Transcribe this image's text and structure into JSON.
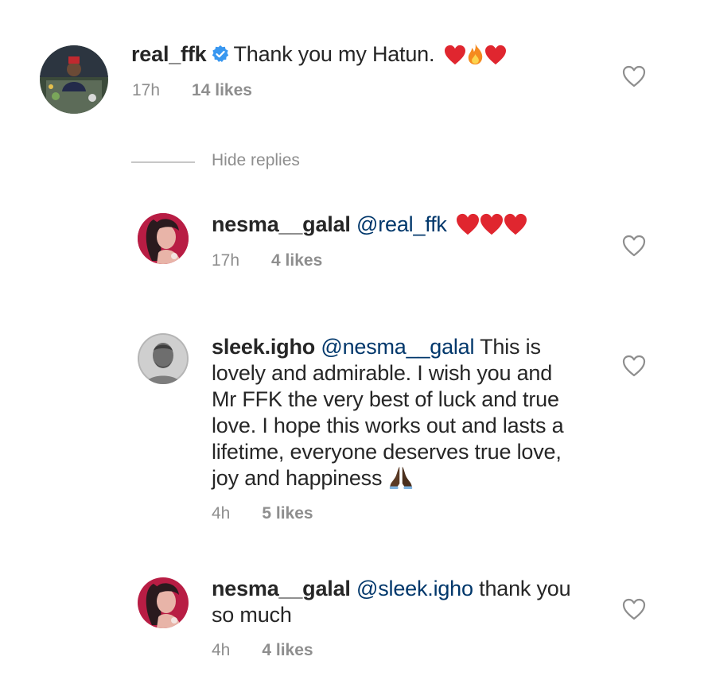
{
  "comments": [
    {
      "username": "real_ffk",
      "verified": true,
      "mention": "",
      "text": "Thank you my Hatun.",
      "emojis": [
        "red-heart",
        "fire",
        "red-heart"
      ],
      "time": "17h",
      "likes": "14 likes"
    }
  ],
  "hide_replies_label": "Hide replies",
  "replies": [
    {
      "username": "nesma__galal",
      "mention": "@real_ffk",
      "text": "",
      "emojis": [
        "red-heart",
        "red-heart",
        "red-heart"
      ],
      "time": "17h",
      "likes": "4 likes"
    },
    {
      "username": "sleek.igho",
      "mention": "@nesma__galal",
      "text_lines": [
        "This is",
        "lovely and admirable. I wish you and",
        "Mr FFK the very best of luck and true",
        "love. I hope this works out and lasts a",
        "lifetime, everyone deserves true love,",
        "joy and happiness"
      ],
      "emojis": [
        "folded-hands"
      ],
      "time": "4h",
      "likes": "5 likes"
    },
    {
      "username": "nesma__galal",
      "mention": "@sleek.igho",
      "text_lines": [
        "thank you",
        "so much"
      ],
      "time": "4h",
      "likes": "4 likes"
    }
  ],
  "colors": {
    "username": "#262626",
    "mention": "#00376b",
    "meta": "#8e8e8e",
    "heart_emoji": "#e0262f",
    "verified": "#3897f0"
  }
}
